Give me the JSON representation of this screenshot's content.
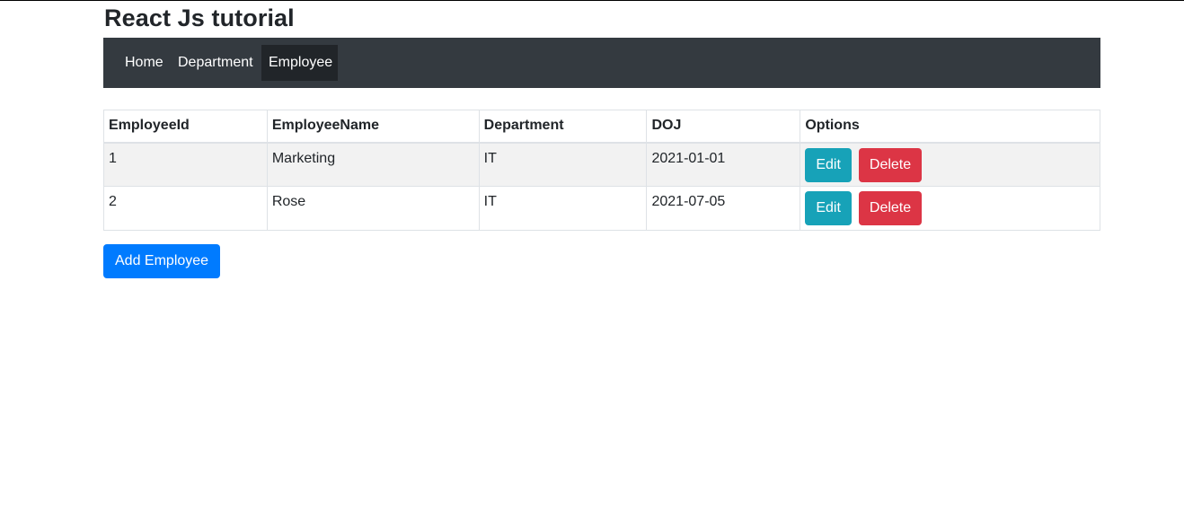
{
  "page": {
    "title": "React Js tutorial"
  },
  "nav": {
    "items": [
      {
        "label": "Home",
        "active": false
      },
      {
        "label": "Department",
        "active": false
      },
      {
        "label": "Employee",
        "active": true
      }
    ]
  },
  "table": {
    "headers": [
      "EmployeeId",
      "EmployeeName",
      "Department",
      "DOJ",
      "Options"
    ],
    "rows": [
      {
        "id": "1",
        "name": "Marketing",
        "department": "IT",
        "doj": "2021-01-01"
      },
      {
        "id": "2",
        "name": "Rose",
        "department": "IT",
        "doj": "2021-07-05"
      }
    ],
    "edit_label": "Edit",
    "delete_label": "Delete"
  },
  "actions": {
    "add_label": "Add Employee"
  },
  "colors": {
    "navbar": "#343a40",
    "nav_active": "#212529",
    "edit": "#17a2b8",
    "delete": "#dc3545",
    "primary": "#007bff",
    "stripe": "#f2f2f2"
  }
}
